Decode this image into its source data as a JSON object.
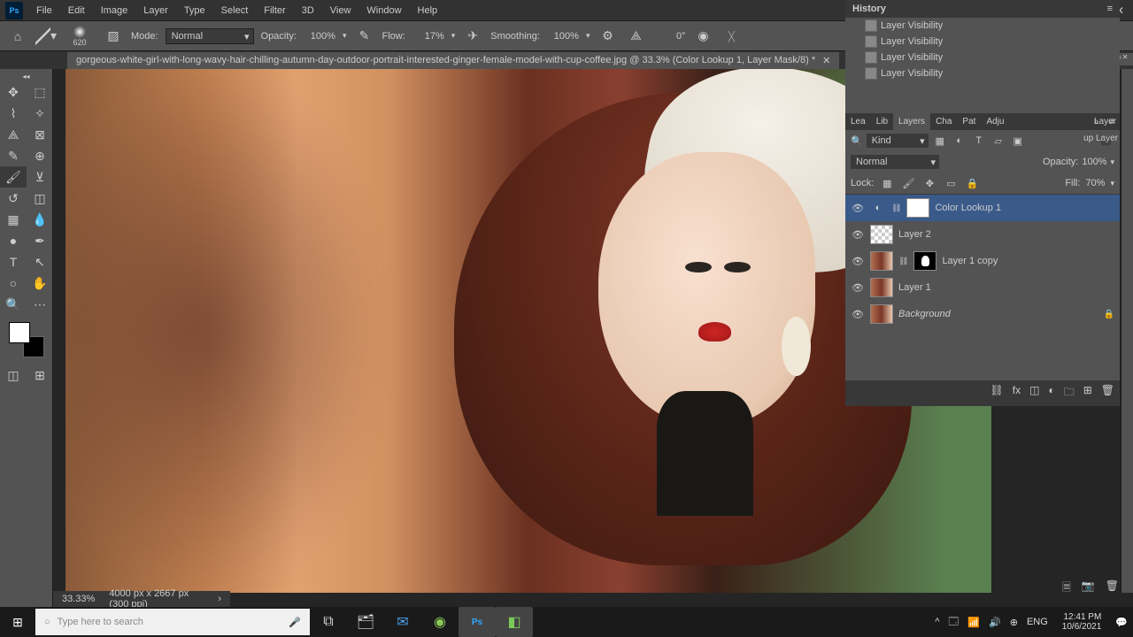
{
  "menubar": [
    "File",
    "Edit",
    "Image",
    "Layer",
    "Type",
    "Select",
    "Filter",
    "3D",
    "View",
    "Window",
    "Help"
  ],
  "options": {
    "brush_size": "620",
    "mode_lbl": "Mode:",
    "mode_val": "Normal",
    "opacity_lbl": "Opacity:",
    "opacity_val": "100%",
    "flow_lbl": "Flow:",
    "flow_val": "17%",
    "smoothing_lbl": "Smoothing:",
    "smoothing_val": "100%",
    "angle": "0°"
  },
  "tab": {
    "title": "gorgeous-white-girl-with-long-wavy-hair-chilling-autumn-day-outdoor-portrait-interested-ginger-female-model-with-cup-coffee.jpg @ 33.3% (Color Lookup 1, Layer Mask/8) *"
  },
  "history": {
    "title": "History",
    "items": [
      "Layer Visibility",
      "Layer Visibility",
      "Layer Visibility",
      "Layer Visibility"
    ]
  },
  "layer_panel": {
    "tabs": [
      "Lea",
      "Lib",
      "Layers",
      "Cha",
      "Pat",
      "Adju"
    ],
    "extra": "Layer",
    "extra2": "up Layer",
    "kind_lbl": "Kind",
    "blend": "Normal",
    "opacity_lbl": "Opacity:",
    "opacity": "100%",
    "lock_lbl": "Lock:",
    "fill_lbl": "Fill:",
    "fill": "70%",
    "layers": [
      {
        "name": "Color Lookup 1",
        "sel": true,
        "thumb": "adj",
        "mask": true
      },
      {
        "name": "Layer 2",
        "thumb": "check"
      },
      {
        "name": "Layer 1 copy",
        "thumb": "img",
        "mask": true
      },
      {
        "name": "Layer 1",
        "thumb": "img"
      },
      {
        "name": "Background",
        "thumb": "img",
        "locked": true,
        "italic": true
      }
    ]
  },
  "status": {
    "zoom": "33.33%",
    "dims": "4000 px x 2667 px (300 ppi)"
  },
  "taskbar": {
    "search_ph": "Type here to search",
    "lang": "ENG",
    "time": "12:41 PM",
    "date": "10/6/2021"
  }
}
